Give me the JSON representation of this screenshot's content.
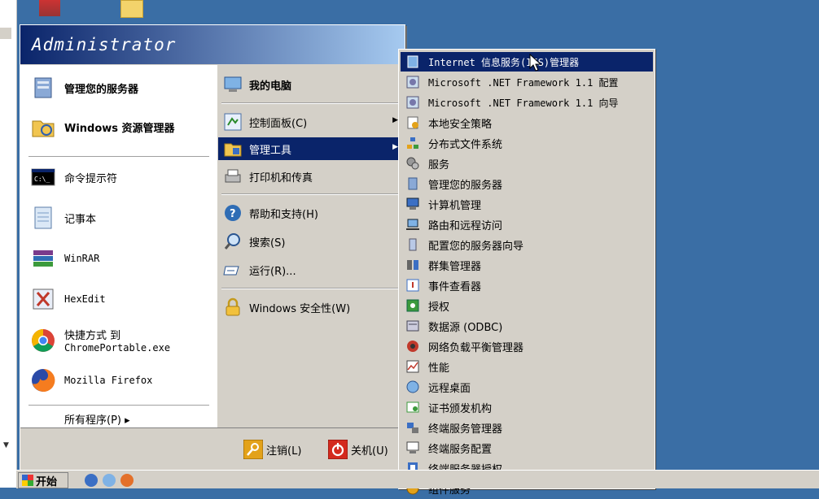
{
  "colors": {
    "desktop": "#3a6ea5",
    "menu_face": "#d4d0c8",
    "selection": "#0a246a",
    "header_gradient_start": "#0a246a",
    "header_gradient_end": "#a6caf0"
  },
  "start_menu": {
    "user": "Administrator",
    "left_pinned": [
      {
        "label": "管理您的服务器",
        "icon": "server-manager-icon"
      },
      {
        "label": "Windows 资源管理器",
        "icon": "explorer-icon"
      }
    ],
    "left_recent": [
      {
        "label": "命令提示符",
        "icon": "cmd-icon"
      },
      {
        "label": "记事本",
        "icon": "notepad-icon"
      },
      {
        "label": "WinRAR",
        "icon": "winrar-icon"
      },
      {
        "label": "HexEdit",
        "icon": "hexedit-icon"
      },
      {
        "label": "快捷方式 到",
        "label2": "ChromePortable.exe",
        "icon": "chrome-icon"
      },
      {
        "label": "Mozilla Firefox",
        "icon": "firefox-icon"
      }
    ],
    "all_programs": "所有程序(P) ▸",
    "right_items": [
      {
        "label": "我的电脑",
        "icon": "my-computer-icon"
      },
      {
        "label": "控制面板(C)",
        "icon": "control-panel-icon"
      },
      {
        "label": "管理工具",
        "icon": "admin-tools-icon"
      },
      {
        "label": "打印机和传真",
        "icon": "printer-icon"
      },
      {
        "label": "帮助和支持(H)",
        "icon": "help-icon"
      },
      {
        "label": "搜索(S)",
        "icon": "search-icon"
      },
      {
        "label": "运行(R)...",
        "icon": "run-icon"
      },
      {
        "label": "Windows 安全性(W)",
        "icon": "security-icon"
      }
    ],
    "logoff": "注销(L)",
    "shutdown": "关机(U)"
  },
  "admin_tools_submenu": [
    "Internet 信息服务(IIS)管理器",
    "Microsoft .NET Framework 1.1 配置",
    "Microsoft .NET Framework 1.1 向导",
    "本地安全策略",
    "分布式文件系统",
    "服务",
    "管理您的服务器",
    "计算机管理",
    "路由和远程访问",
    "配置您的服务器向导",
    "群集管理器",
    "事件查看器",
    "授权",
    "数据源 (ODBC)",
    "网络负载平衡管理器",
    "性能",
    "远程桌面",
    "证书颁发机构",
    "终端服务管理器",
    "终端服务配置",
    "终端服务器授权",
    "组件服务"
  ],
  "taskbar": {
    "start": "开始"
  }
}
